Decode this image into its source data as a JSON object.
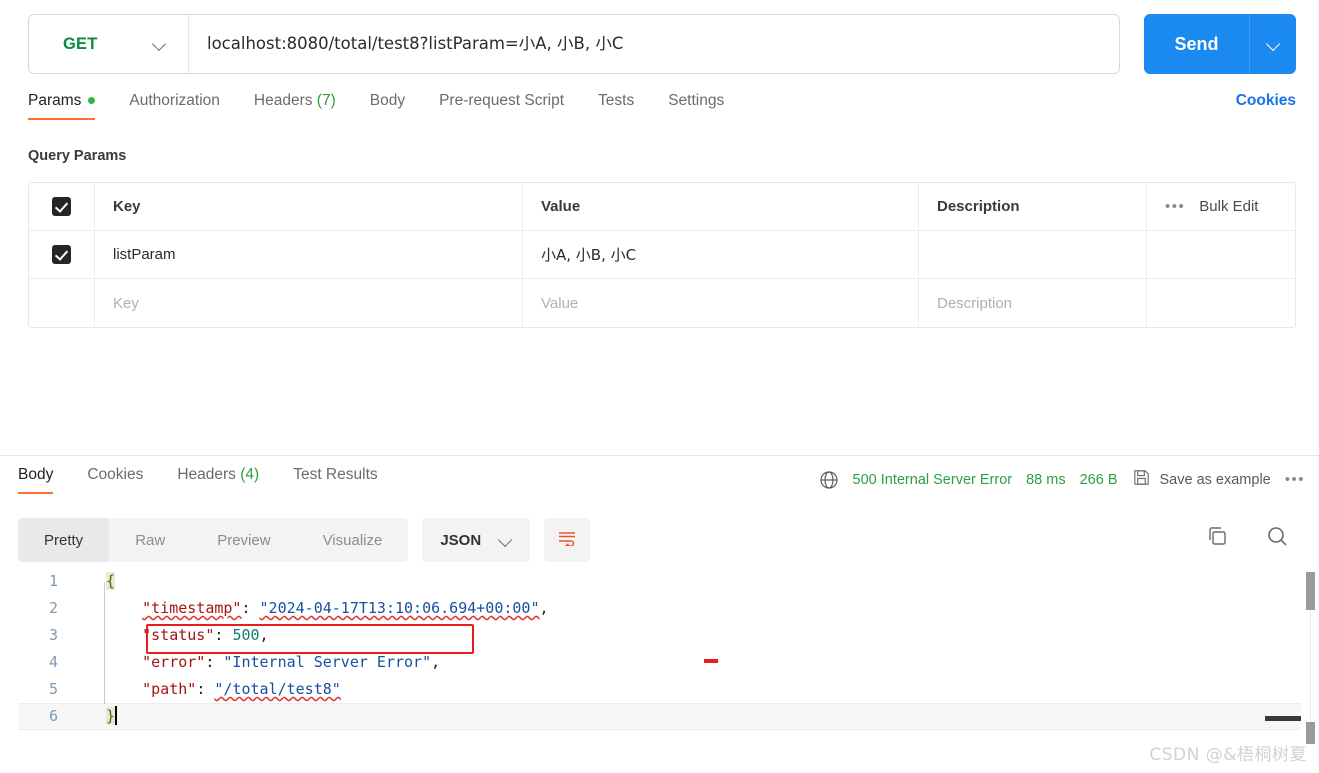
{
  "request": {
    "method": "GET",
    "method_caret_icon": "chevron-down-icon",
    "url": "localhost:8080/total/test8?listParam=小A, 小B, 小C",
    "send_label": "Send",
    "send_caret_icon": "chevron-down-icon"
  },
  "request_tabs": {
    "items": [
      {
        "label": "Params",
        "active": true,
        "dot": true
      },
      {
        "label": "Authorization",
        "active": false
      },
      {
        "label": "Headers",
        "count": "(7)",
        "active": false
      },
      {
        "label": "Body",
        "active": false
      },
      {
        "label": "Pre-request Script",
        "active": false
      },
      {
        "label": "Tests",
        "active": false
      },
      {
        "label": "Settings",
        "active": false
      }
    ],
    "cookies_label": "Cookies"
  },
  "query_params": {
    "section_title": "Query Params",
    "headers": {
      "key": "Key",
      "value": "Value",
      "description": "Description",
      "more_icon": "ellipsis-icon",
      "bulk_edit": "Bulk Edit"
    },
    "rows": [
      {
        "checked": true,
        "key": "listParam",
        "value": "小A, 小B, 小C",
        "description": ""
      }
    ],
    "placeholder_row": {
      "key": "Key",
      "value": "Value",
      "description": "Description"
    }
  },
  "response": {
    "tabs": [
      {
        "label": "Body",
        "active": true
      },
      {
        "label": "Cookies",
        "active": false
      },
      {
        "label": "Headers",
        "count": "(4)",
        "active": false
      },
      {
        "label": "Test Results",
        "active": false
      }
    ],
    "meta": {
      "globe_icon": "globe-icon",
      "status": "500 Internal Server Error",
      "time": "88 ms",
      "size": "266 B",
      "save_icon": "floppy-disk-icon",
      "save_label": "Save as example",
      "more_icon": "ellipsis-icon",
      "status_color": "#2f9e44"
    },
    "view_modes": [
      {
        "label": "Pretty",
        "active": true
      },
      {
        "label": "Raw",
        "active": false
      },
      {
        "label": "Preview",
        "active": false
      },
      {
        "label": "Visualize",
        "active": false
      }
    ],
    "format": {
      "label": "JSON",
      "caret_icon": "chevron-down-icon"
    },
    "wrap_icon": "word-wrap-icon",
    "copy_icon": "copy-icon",
    "search_icon": "search-icon",
    "body_lines": [
      {
        "n": "1",
        "text": "{"
      },
      {
        "n": "2",
        "text": "    \"timestamp\": \"2024-04-17T13:10:06.694+00:00\","
      },
      {
        "n": "3",
        "text": "    \"status\": 500,"
      },
      {
        "n": "4",
        "text": "    \"error\": \"Internal Server Error\","
      },
      {
        "n": "5",
        "text": "    \"path\": \"/total/test8\""
      },
      {
        "n": "6",
        "text": "}"
      }
    ],
    "body_json": {
      "timestamp": "2024-04-17T13:10:06.694+00:00",
      "status": 500,
      "error": "Internal Server Error",
      "path": "/total/test8"
    },
    "tokens": {
      "l1_brace": "{",
      "l2_key": "\"timestamp\"",
      "l2_colon": ": ",
      "l2_val": "\"2024-04-17T13:10:06.694+00:00\"",
      "l2_comma": ",",
      "l3_key": "\"status\"",
      "l3_colon": ": ",
      "l3_val": "500",
      "l3_comma": ",",
      "l4_key": "\"error\"",
      "l4_colon": ": ",
      "l4_val": "\"Internal Server Error\"",
      "l4_comma": ",",
      "l5_key": "\"path\"",
      "l5_colon": ": ",
      "l5_val": "\"/total/test8\"",
      "l6_brace": "}"
    }
  },
  "annotations": {
    "highlight_box_target": "status-line",
    "red_dash": ""
  },
  "watermark": "CSDN @&梧桐树夏",
  "colors": {
    "accent_orange": "#ff6c37",
    "send_blue": "#1a89f0",
    "method_green": "#0d8a3f",
    "status_green": "#2f9e44",
    "annotation_red": "#e81c1c",
    "link_blue": "#1a73e8"
  }
}
